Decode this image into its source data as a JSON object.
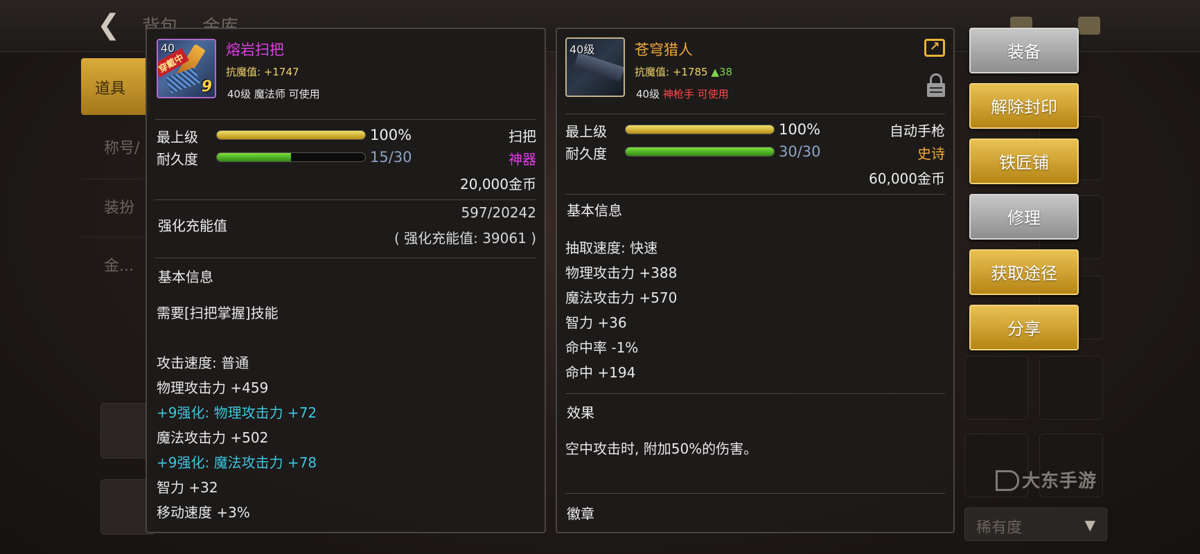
{
  "background": {
    "top_tabs": [
      "背包",
      "金库"
    ],
    "left_tab_active": "道具",
    "left_tabs": [
      "称号/",
      "装扮",
      "金..."
    ],
    "rarity_filter": "稀有度",
    "watermark": "大东手游"
  },
  "left_item": {
    "name": "熔岩扫把",
    "name_color": "#e23ee4",
    "icon_level": "40",
    "icon_badge": "穿戴中",
    "icon_enhance": "9",
    "resist_label": "抗魔值: +1747",
    "level_class": "40级 魔法师 可使用",
    "grade_label": "最上级",
    "grade_value": "100%",
    "grade_fraction": 1.0,
    "durability_label": "耐久度",
    "durability_value": "15/30",
    "durability_fraction": 0.5,
    "type": "扫把",
    "rarity": "神器",
    "price": "20,000金币",
    "charge_label": "强化充能值",
    "charge_value": "597/20242",
    "charge_sub": "( 强化充能值: 39061 )",
    "section_title": "基本信息",
    "lines": [
      {
        "text": "需要[扫把掌握]技能",
        "style": "normal"
      },
      {
        "text": "",
        "style": "normal"
      },
      {
        "text": "攻击速度: 普通",
        "style": "normal"
      },
      {
        "text": "物理攻击力 +459",
        "style": "normal"
      },
      {
        "text": "+9强化: 物理攻击力 +72",
        "style": "cyan"
      },
      {
        "text": "魔法攻击力 +502",
        "style": "normal"
      },
      {
        "text": "+9强化: 魔法攻击力 +78",
        "style": "cyan"
      },
      {
        "text": "智力 +32",
        "style": "normal"
      },
      {
        "text": "移动速度 +3%",
        "style": "normal"
      }
    ]
  },
  "right_item": {
    "name": "苍穹猎人",
    "name_color": "#f0a93a",
    "icon_level": "40级",
    "resist_label": "抗魔值: +1785",
    "resist_diff": "▲38",
    "level_prefix": "40级",
    "level_class": "神枪手 可使用",
    "grade_label": "最上级",
    "grade_value": "100%",
    "grade_fraction": 1.0,
    "durability_label": "耐久度",
    "durability_value": "30/30",
    "durability_fraction": 1.0,
    "type": "自动手枪",
    "rarity": "史诗",
    "price": "60,000金币",
    "section_title": "基本信息",
    "lines": [
      "抽取速度: 快速",
      "物理攻击力 +388",
      "魔法攻击力 +570",
      "智力 +36",
      "命中率 -1%",
      "命中 +194"
    ],
    "effect_title": "效果",
    "effect_text": "空中攻击时, 附加50%的伤害。",
    "badge_title": "徽章"
  },
  "actions": [
    {
      "label": "装备",
      "style": "gray"
    },
    {
      "label": "解除封印",
      "style": "gold"
    },
    {
      "label": "铁匠铺",
      "style": "gold"
    },
    {
      "label": "修理",
      "style": "gray"
    },
    {
      "label": "获取途径",
      "style": "gold"
    },
    {
      "label": "分享",
      "style": "gold"
    }
  ],
  "icons": {
    "back": "back-arrow-icon",
    "share": "share-icon",
    "lock": "lock-icon",
    "dropdown": "dropdown-arrow-icon"
  }
}
